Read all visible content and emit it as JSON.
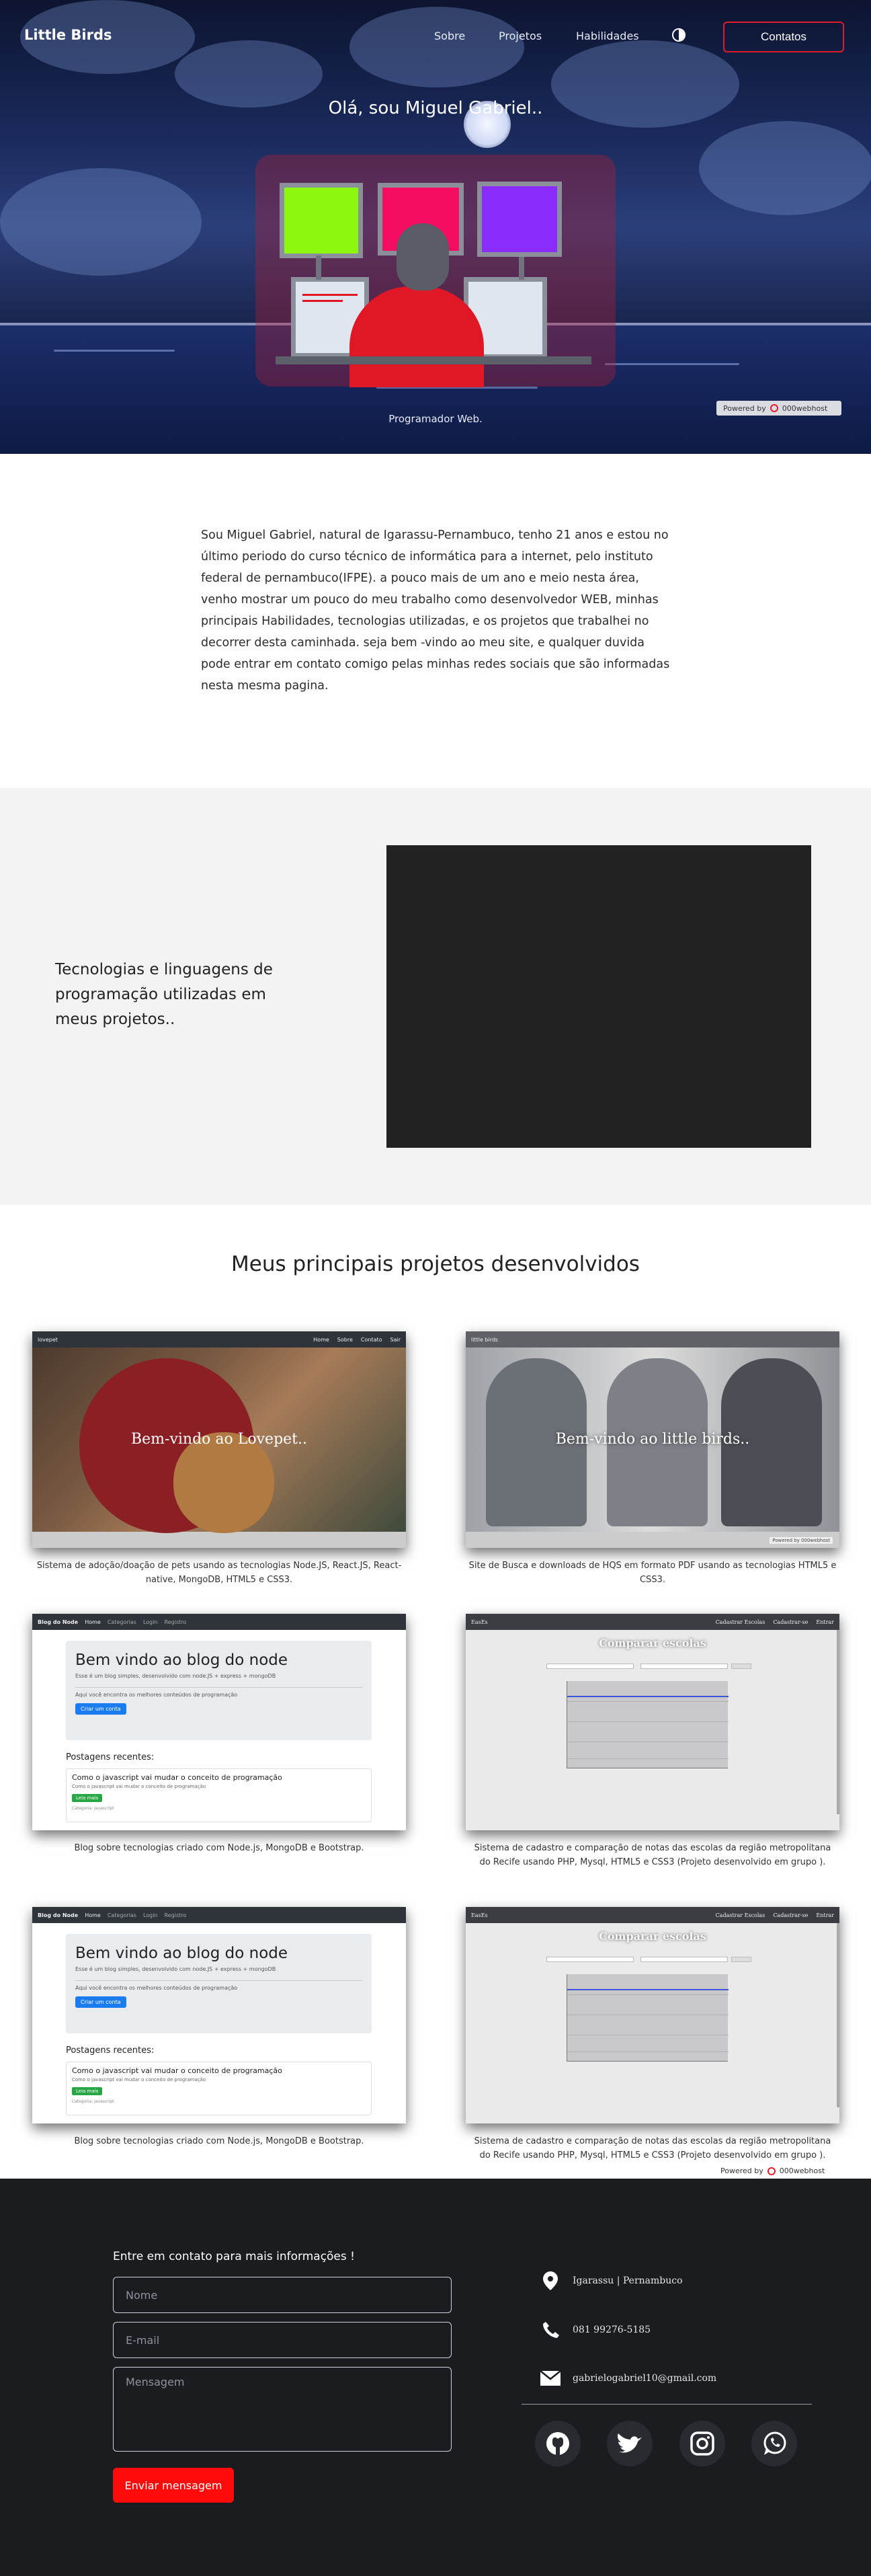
{
  "nav": {
    "logo": "Little Birds",
    "links": [
      "Sobre",
      "Projetos",
      "Habilidades"
    ],
    "contact_button": "Contatos"
  },
  "hero": {
    "title": "Olá, sou Miguel Gabriel..",
    "subtitle": "Programador Web.",
    "badge_powered": "Powered by",
    "badge_brand": "000webhost"
  },
  "about": {
    "text": "Sou Miguel Gabriel, natural de Igarassu-Pernambuco, tenho 21 anos e estou no último periodo do curso técnico de informática para a internet, pelo instituto federal de pernambuco(IFPE). a pouco mais de um ano e meio nesta área, venho mostrar um pouco do meu trabalho como desenvolvedor WEB, minhas principais Habilidades, tecnologias utilizadas, e os projetos que trabalhei no decorrer desta caminhada. seja bem -vindo ao meu site, e qualquer duvida pode entrar em contato comigo pelas minhas redes sociais que são informadas nesta mesma pagina."
  },
  "tech": {
    "text": "Tecnologias e linguagens de programação utilizadas em meus projetos.."
  },
  "projects": {
    "title": "Meus principais projetos desenvolvidos",
    "items": [
      {
        "caption": "Sistema de adoção/doação de pets usando as tecnologias Node.JS, React.JS, React-native, MongoDB, HTML5 e CSS3.",
        "screen_text": "Bem-vindo ao Lovepet..",
        "nav_brand": "lovepet",
        "nav_links": [
          "Home",
          "Sobre",
          "Contato",
          "Sair"
        ]
      },
      {
        "caption": "Site de Busca e downloads de HQS em formato PDF usando as tecnologias HTML5 e CSS3.",
        "screen_text": "Bem-vindo ao little birds..",
        "nav_brand": "little birds",
        "powered": "Powered by 000webhost"
      },
      {
        "caption": "Blog sobre tecnologias criado com Node.js, MongoDB e Bootstrap.",
        "nav_brand": "Blog do Node",
        "nav_links": [
          "Home",
          "Categorias",
          "Login",
          "Registro"
        ],
        "jumbo_title": "Bem vindo ao blog do node",
        "jumbo_sub": "Esse é um blog simples, desenvolvido com node.JS + express + mongoDB",
        "jumbo_note": "Aqui você encontra os melhores conteúdos de programação",
        "jumbo_btn": "Criar um conta",
        "posts_heading": "Postagens recentes:",
        "post_title": "Como o javascript vai mudar o conceito de programação",
        "post_sub": "Como o javascript vai mudar o conceito de programação",
        "post_btn": "Leia mais",
        "post_cat": "Categoria: Javascript"
      },
      {
        "caption": "Sistema de cadastro e comparação de notas das escolas da região metropolitana do Recife usando PHP, Mysql, HTML5 e CSS3 (Projeto desenvolvido em grupo ).",
        "nav_brand": "EasEs",
        "nav_links": [
          "Cadastrar Escolas",
          "Cadastrar-se",
          "Entrar"
        ],
        "screen_title": "Comparar escolas"
      },
      {
        "caption": "Blog sobre tecnologias criado com Node.js, MongoDB e Bootstrap.",
        "nav_brand": "Blog do Node",
        "nav_links": [
          "Home",
          "Categorias",
          "Login",
          "Registro"
        ],
        "jumbo_title": "Bem vindo ao blog do node",
        "jumbo_sub": "Esse é um blog simples, desenvolvido com node.JS + express + mongoDB",
        "jumbo_note": "Aqui você encontra os melhores conteúdos de programação",
        "jumbo_btn": "Criar um conta",
        "posts_heading": "Postagens recentes:",
        "post_title": "Como o javascript vai mudar o conceito de programação",
        "post_sub": "Como o javascript vai mudar o conceito de programação",
        "post_btn": "Leia mais",
        "post_cat": "Categoria: Javascript"
      },
      {
        "caption": "Sistema de cadastro e comparação de notas das escolas da região metropolitana do Recife usando PHP, Mysql, HTML5 e CSS3 (Projeto desenvolvido em grupo ).",
        "nav_brand": "EasEs",
        "nav_links": [
          "Cadastrar Escolas",
          "Cadastrar-se",
          "Entrar"
        ],
        "screen_title": "Comparar escolas"
      }
    ]
  },
  "powered_bar": {
    "label": "Powered by",
    "brand": "000webhost"
  },
  "footer": {
    "heading": "Entre em contato para mais informações !",
    "name_placeholder": "Nome",
    "email_placeholder": "E-mail",
    "message_placeholder": "Mensagem",
    "send_button": "Enviar mensagem",
    "location": "Igarassu | Pernambuco",
    "phone": "081 99276-5185",
    "email": "gabrielogabriel10@gmail.com",
    "socials": [
      "github-icon",
      "twitter-icon",
      "instagram-icon",
      "whatsapp-icon"
    ]
  },
  "colors": {
    "accent": "#e31c2d",
    "send_button": "#ff0b0b",
    "footer_bg": "#1b1c20",
    "tech_bg": "#f3f3f3"
  }
}
